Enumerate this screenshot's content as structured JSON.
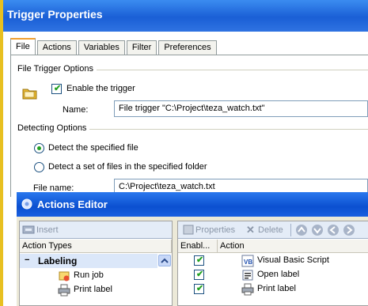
{
  "trigger_window": {
    "title": "Trigger Properties",
    "tabs": [
      "File",
      "Actions",
      "Variables",
      "Filter",
      "Preferences"
    ],
    "file_trigger_group": "File Trigger Options",
    "enable_label": "Enable the trigger",
    "enable_checked": true,
    "name_label": "Name:",
    "name_value": "File trigger \"C:\\Project\\teza_watch.txt\"",
    "detecting_group": "Detecting Options",
    "radio_specified_file": "Detect the specified file",
    "radio_set_of_files": "Detect a set of files in the specified folder",
    "file_name_label": "File name:",
    "file_name_value": "C:\\Project\\teza_watch.txt"
  },
  "actions_editor": {
    "title": "Actions Editor",
    "left_toolbar": {
      "insert_label": "Insert"
    },
    "right_toolbar": {
      "properties_label": "Properties",
      "delete_label": "Delete"
    },
    "left_header": "Action Types",
    "tree": [
      {
        "label": "Labeling",
        "expander": "−",
        "bold": true
      },
      {
        "label": "Run job",
        "bold": false
      },
      {
        "label": "Print label",
        "bold": false
      }
    ],
    "right_headers": [
      "Enabl...",
      "Action"
    ],
    "actions": [
      {
        "enabled": true,
        "label": "Visual Basic Script"
      },
      {
        "enabled": true,
        "label": "Open label"
      },
      {
        "enabled": true,
        "label": "Print label"
      }
    ]
  },
  "colors": {
    "title_bar": "#1a5fd6",
    "window_bg": "#ece9d8",
    "check_green": "#21a121",
    "outer_border": "#e8c020"
  }
}
